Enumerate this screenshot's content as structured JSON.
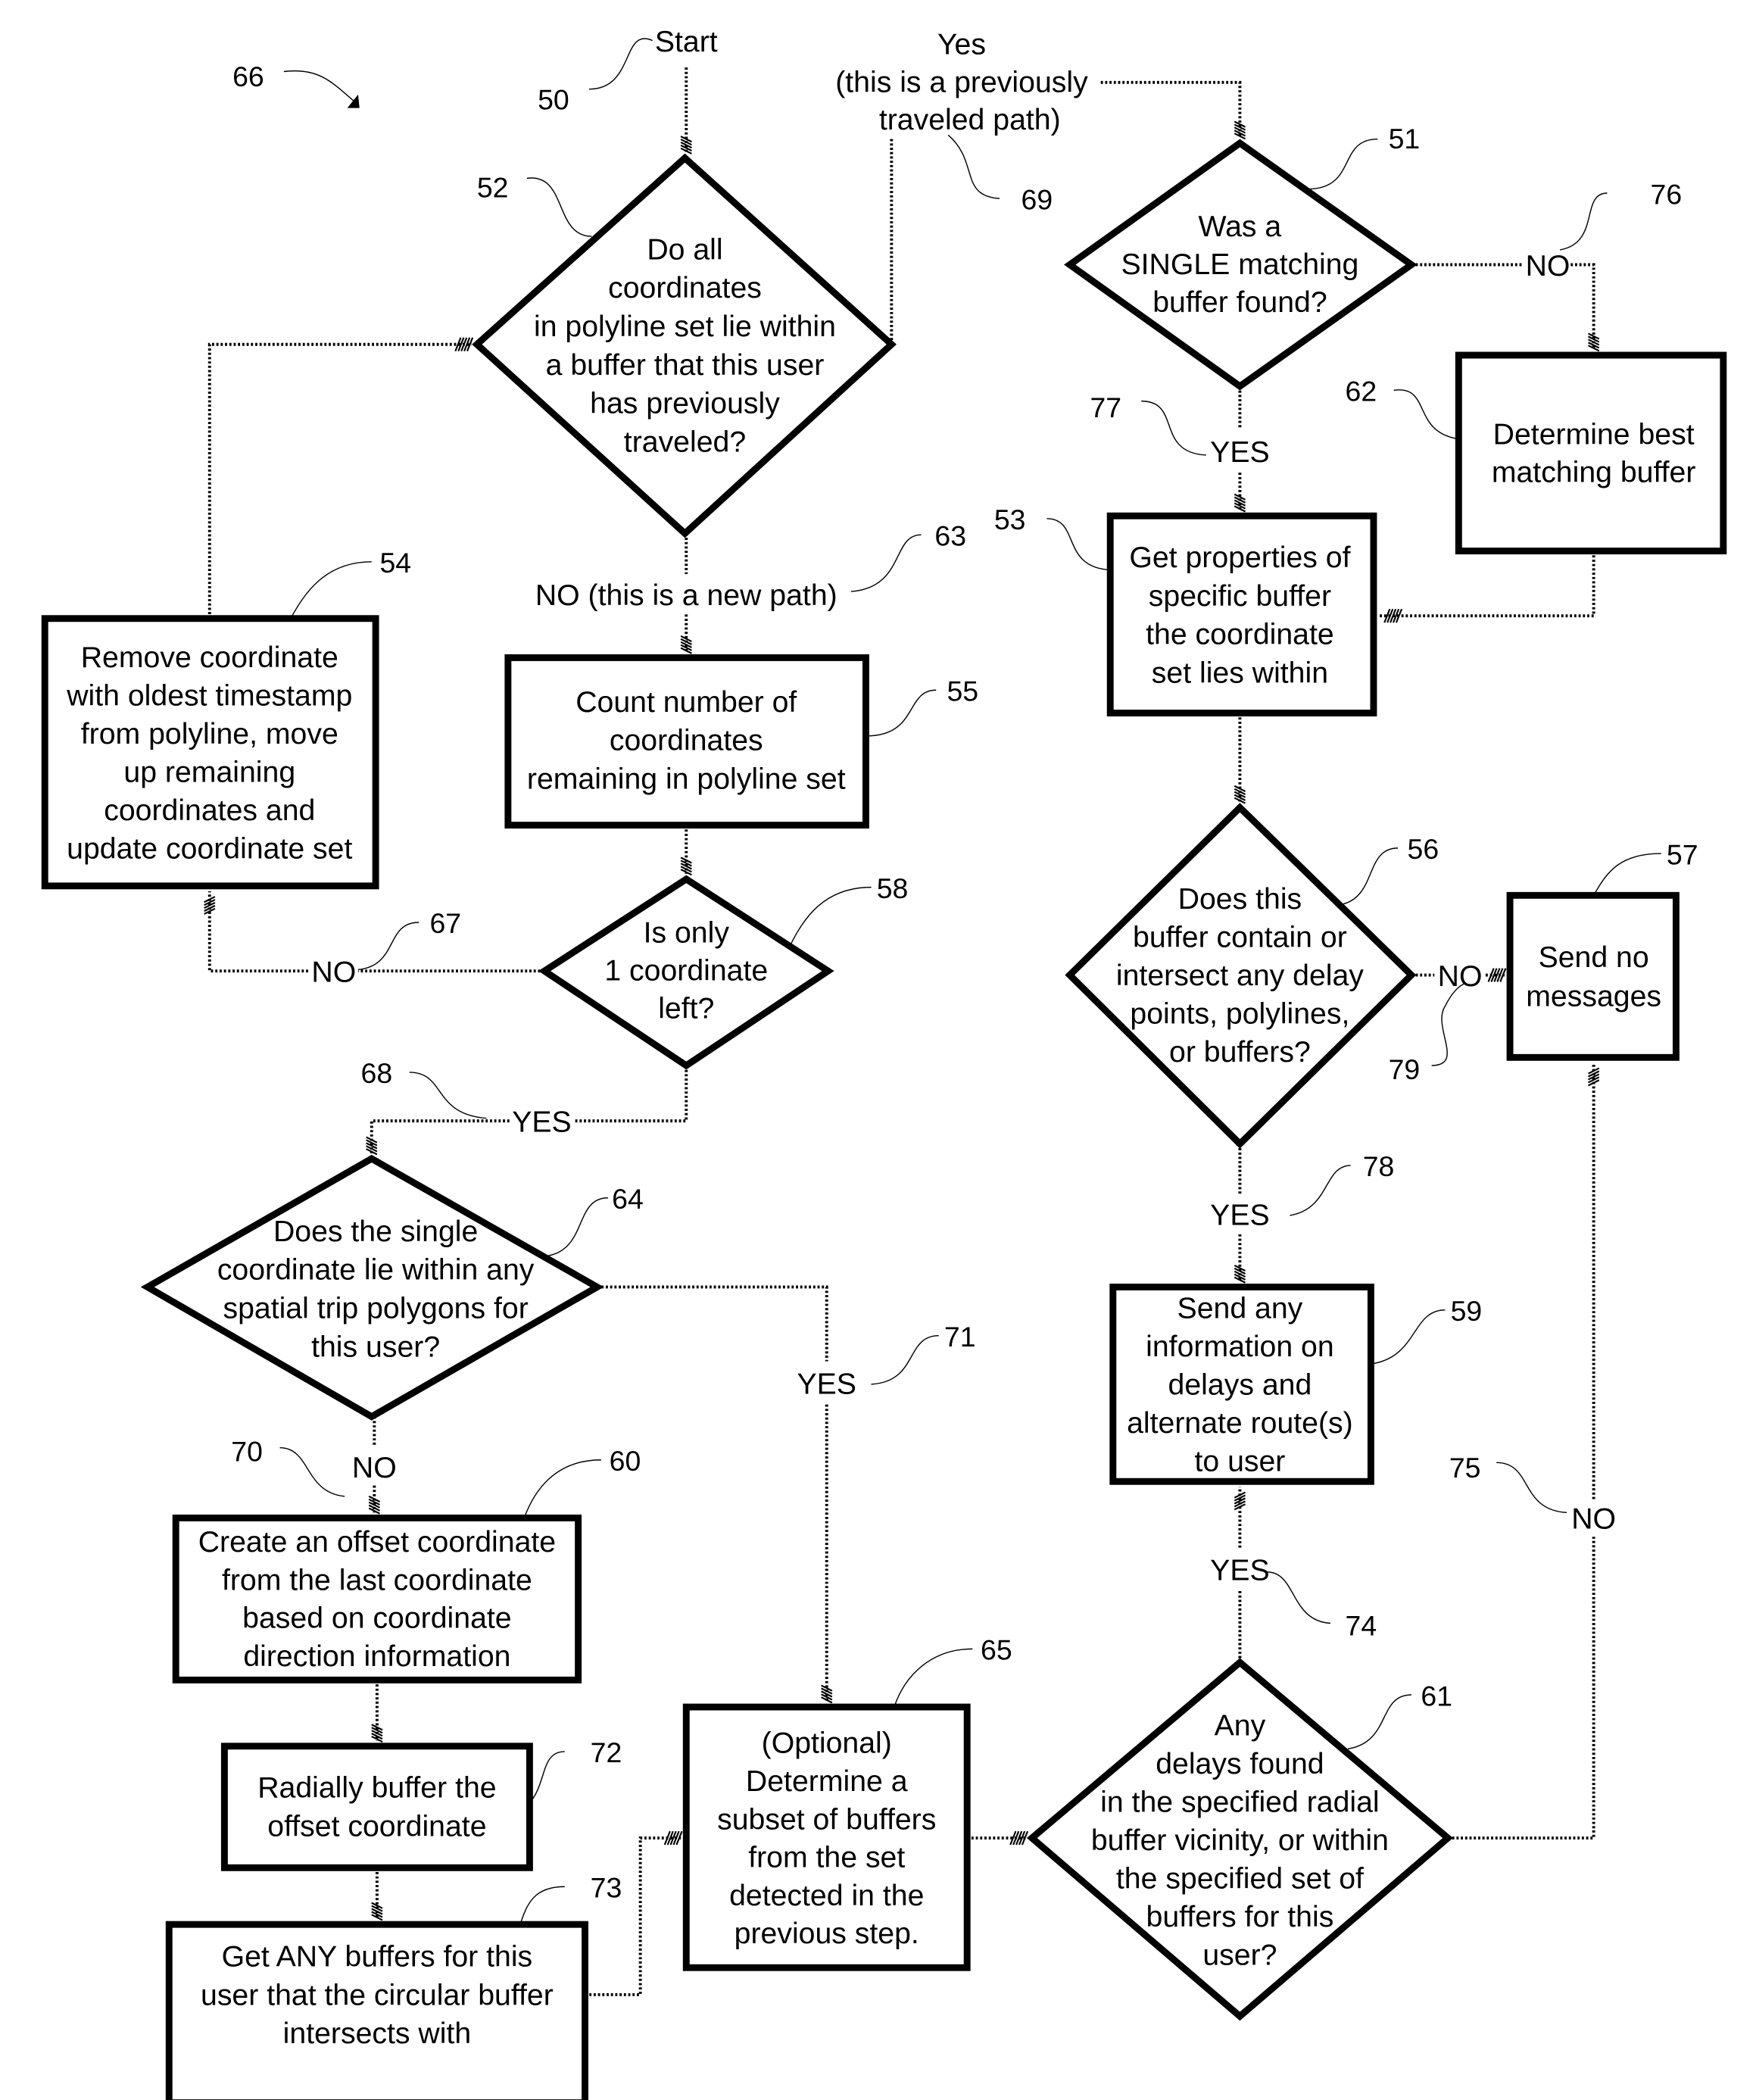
{
  "figure": {
    "ref": "66",
    "colors": {
      "ink": "#000000",
      "background": "#ffffff"
    }
  },
  "start": {
    "label": "Start",
    "ref": "50"
  },
  "nodes": {
    "n52": {
      "type": "decision",
      "ref": "52",
      "lines": [
        "Do all",
        "coordinates",
        "in polyline set lie within",
        "a buffer that this user",
        "has previously",
        "traveled?"
      ]
    },
    "n51": {
      "type": "decision",
      "ref": "51",
      "lines": [
        "Was a",
        "SINGLE matching",
        "buffer found?"
      ]
    },
    "n62": {
      "type": "process",
      "ref": "62",
      "lines": [
        "Determine best",
        "matching buffer"
      ]
    },
    "n53": {
      "type": "process",
      "ref": "53",
      "lines": [
        "Get properties of",
        "specific buffer",
        "the coordinate",
        "set lies within"
      ]
    },
    "n54": {
      "type": "process",
      "ref": "54",
      "lines": [
        "Remove coordinate",
        "with oldest timestamp",
        "from polyline, move",
        "up remaining",
        "coordinates and",
        "update coordinate set"
      ]
    },
    "n55": {
      "type": "process",
      "ref": "55",
      "lines": [
        "Count number of",
        "coordinates",
        "remaining in polyline set"
      ]
    },
    "n58": {
      "type": "decision",
      "ref": "58",
      "lines": [
        "Is only",
        "1 coordinate",
        "left?"
      ]
    },
    "n56": {
      "type": "decision",
      "ref": "56",
      "lines": [
        "Does this",
        "buffer contain or",
        "intersect any delay",
        "points, polylines,",
        "or buffers?"
      ]
    },
    "n57": {
      "type": "process",
      "ref": "57",
      "lines": [
        "Send no",
        "messages"
      ]
    },
    "n64": {
      "type": "decision",
      "ref": "64",
      "lines": [
        "Does the single",
        "coordinate lie within any",
        "spatial trip polygons for",
        "this user?"
      ]
    },
    "n59": {
      "type": "process",
      "ref": "59",
      "lines": [
        "Send any",
        "information on",
        "delays and",
        "alternate route(s)",
        "to user"
      ]
    },
    "n60": {
      "type": "process",
      "ref": "60",
      "lines": [
        "Create an offset coordinate",
        "from the last coordinate",
        "based on coordinate",
        "direction information"
      ]
    },
    "n72": {
      "type": "process",
      "ref": "72",
      "lines": [
        "Radially buffer the",
        "offset coordinate"
      ]
    },
    "n65": {
      "type": "process",
      "ref": "65",
      "lines": [
        "(Optional)",
        "Determine a",
        "subset of buffers",
        "from the set",
        "detected in the",
        "previous step."
      ]
    },
    "n61": {
      "type": "decision",
      "ref": "61",
      "lines": [
        "Any",
        "delays found",
        "in the specified radial",
        "buffer vicinity, or within",
        "the specified set of",
        "buffers for this",
        "user?"
      ]
    },
    "n73": {
      "type": "process",
      "ref": "73",
      "lines": [
        "Get ANY buffers for this",
        "user that the circular buffer",
        "intersects with"
      ]
    }
  },
  "branches": {
    "b69": {
      "ref": "69",
      "lines": [
        "Yes",
        "(this is a previously",
        "traveled path)"
      ]
    },
    "b63": {
      "ref": "63",
      "label": "NO (this is a new path)"
    },
    "b76": {
      "ref": "76",
      "label": "NO"
    },
    "b77": {
      "ref": "77",
      "label": "YES"
    },
    "b67": {
      "ref": "67",
      "label": "NO"
    },
    "b68": {
      "ref": "68",
      "label": "YES"
    },
    "b79": {
      "ref": "79",
      "label": "NO"
    },
    "b78": {
      "ref": "78",
      "label": "YES"
    },
    "b70": {
      "ref": "70",
      "label": "NO"
    },
    "b71": {
      "ref": "71",
      "label": "YES"
    },
    "b74": {
      "ref": "74",
      "label": "YES"
    },
    "b75": {
      "ref": "75",
      "label": "NO"
    }
  }
}
